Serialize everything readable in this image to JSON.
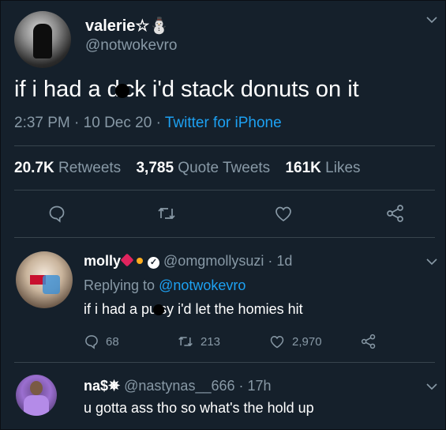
{
  "main_tweet": {
    "name": "valerie☆⛄",
    "handle": "@notwokevro",
    "text_before": "if i had a d",
    "text_after": "ck i'd stack donuts on it",
    "time": "2:37 PM",
    "date": "10 Dec 20",
    "source": "Twitter for iPhone",
    "retweets_count": "20.7K",
    "retweets_label": "Retweets",
    "quotes_count": "3,785",
    "quotes_label": "Quote Tweets",
    "likes_count": "161K",
    "likes_label": "Likes"
  },
  "reply1": {
    "name": "molly",
    "handle": "@omgmollysuzi",
    "age": "1d",
    "replying_label": "Replying to",
    "replying_to": "@notwokevro",
    "text_before": "if i had a pu",
    "text_after": "sy i'd let the homies hit",
    "reply_count": "68",
    "retweet_count": "213",
    "like_count": "2,970"
  },
  "reply2": {
    "name": "na$✵",
    "handle": "@nastynas__666",
    "age": "17h",
    "text": "u gotta ass tho so what's the hold up"
  },
  "icons": [
    "chevron-down-icon",
    "reply-icon",
    "retweet-icon",
    "like-icon",
    "share-icon",
    "verified-icon"
  ],
  "colors": {
    "background": "#15202b",
    "muted": "#8899a6",
    "link": "#1da1f2",
    "divider": "#38444d"
  }
}
